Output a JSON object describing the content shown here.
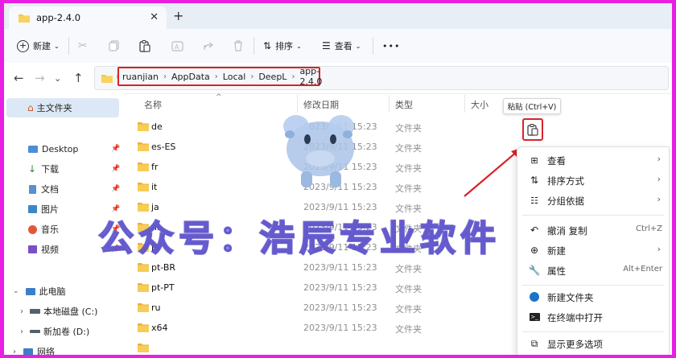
{
  "tab": {
    "title": "app-2.4.0",
    "close": "✕",
    "new": "+"
  },
  "toolbar": {
    "new_label": "新建",
    "sort_label": "排序",
    "view_label": "查看",
    "more": "•••"
  },
  "breadcrumb": [
    "ruanjian",
    "AppData",
    "Local",
    "DeepL",
    "app-2.4.0"
  ],
  "sidebar": {
    "home": "主文件夹",
    "quick": [
      {
        "label": "Desktop",
        "icon": "desktop-icon"
      },
      {
        "label": "下载",
        "icon": "download-icon"
      },
      {
        "label": "文档",
        "icon": "document-icon"
      },
      {
        "label": "图片",
        "icon": "picture-icon"
      },
      {
        "label": "音乐",
        "icon": "music-icon"
      },
      {
        "label": "视频",
        "icon": "video-icon"
      }
    ],
    "this_pc": "此电脑",
    "drives": [
      {
        "label": "本地磁盘 (C:)"
      },
      {
        "label": "新加卷 (D:)"
      }
    ],
    "network": "网络"
  },
  "columns": {
    "name": "名称",
    "date": "修改日期",
    "type": "类型",
    "size": "大小"
  },
  "files": [
    {
      "name": "de",
      "date": "2023/9/11 15:23",
      "type": "文件夹"
    },
    {
      "name": "es-ES",
      "date": "2023/9/11 15:23",
      "type": "文件夹"
    },
    {
      "name": "fr",
      "date": "2023/9/11 15:23",
      "type": "文件夹"
    },
    {
      "name": "it",
      "date": "2023/9/11 15:23",
      "type": "文件夹"
    },
    {
      "name": "ja",
      "date": "2023/9/11 15:23",
      "type": "文件夹"
    },
    {
      "name": "nl",
      "date": "2023/9/11 15:23",
      "type": "文件夹"
    },
    {
      "name": "pl",
      "date": "2023/9/11 15:23",
      "type": "文件夹"
    },
    {
      "name": "pt-BR",
      "date": "2023/9/11 15:23",
      "type": "文件夹"
    },
    {
      "name": "pt-PT",
      "date": "2023/9/11 15:23",
      "type": "文件夹"
    },
    {
      "name": "ru",
      "date": "2023/9/11 15:23",
      "type": "文件夹"
    },
    {
      "name": "x64",
      "date": "2023/9/11 15:23",
      "type": "文件夹"
    }
  ],
  "tooltip": "粘贴 (Ctrl+V)",
  "context_menu": {
    "view": "查看",
    "sort": "排序方式",
    "group": "分组依据",
    "undo_label": "撤消 复制",
    "undo_key": "Ctrl+Z",
    "new": "新建",
    "properties": "属性",
    "properties_key": "Alt+Enter",
    "new_folder": "新建文件夹",
    "terminal": "在终端中打开",
    "more_options": "显示更多选项",
    "arrow": "›"
  },
  "watermark": "公众号：浩辰专业软件",
  "colors": {
    "highlight": "#d8232a",
    "folder": "#f3c74a",
    "border": "#e91ee3"
  }
}
